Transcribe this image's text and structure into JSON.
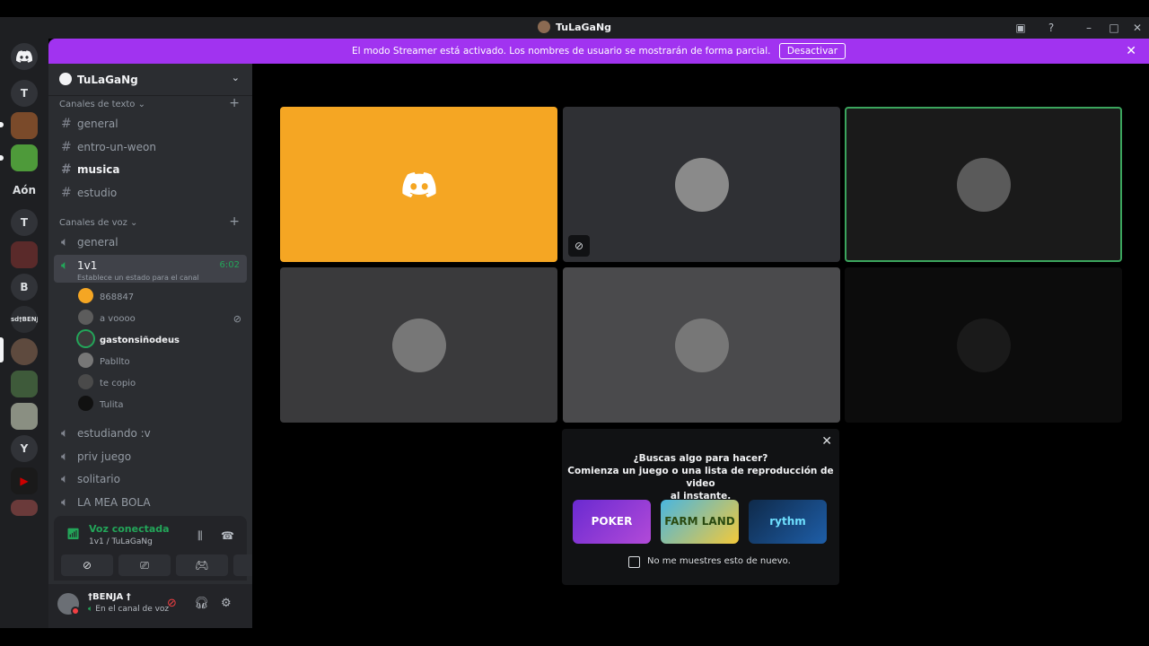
{
  "window": {
    "title": "TuLaGaNg"
  },
  "banner": {
    "message": "El modo Streamer está activado. Los nombres de usuario se mostrarán de forma parcial.",
    "button": "Desactivar"
  },
  "rail": {
    "servers": [
      "T",
      "Aón",
      "T",
      "B",
      "Y"
    ]
  },
  "guild": {
    "name": "TuLaGaNg"
  },
  "categories": {
    "text": "Canales de texto",
    "voice": "Canales de voz"
  },
  "text_channels": [
    "general",
    "entro-un-weon",
    "musica",
    "estudio"
  ],
  "voice_channels": {
    "general": "general",
    "active": {
      "name": "1v1",
      "timer": "6:02",
      "status": "Establece un estado para el canal"
    },
    "others": [
      "estudiando :v",
      "priv juego",
      "solitario",
      "LA MEA BOLA"
    ]
  },
  "voice_users": [
    "868847",
    "a voooo",
    "gastonsiñodeus",
    "Pabllto",
    "te copio",
    "Tulita"
  ],
  "voice_panel": {
    "state": "Voz conectada",
    "location": "1v1 / TuLaGaNg"
  },
  "user": {
    "name": "†BENJA †",
    "status": "En el canal de voz"
  },
  "activity": {
    "line1": "¿Buscas algo para hacer?",
    "line2": "Comienza un juego o una lista de reproducción de video",
    "line3": "al instante.",
    "apps": [
      "POKER",
      "FARM LAND",
      "rythm"
    ],
    "checkbox": "No me muestres esto de nuevo."
  },
  "colors": {
    "brand": "#5865f2",
    "streamer_banner": "#a133f0",
    "speaking": "#23a559",
    "discord_tile": "#f5a623",
    "mute_red": "#f23f43"
  }
}
